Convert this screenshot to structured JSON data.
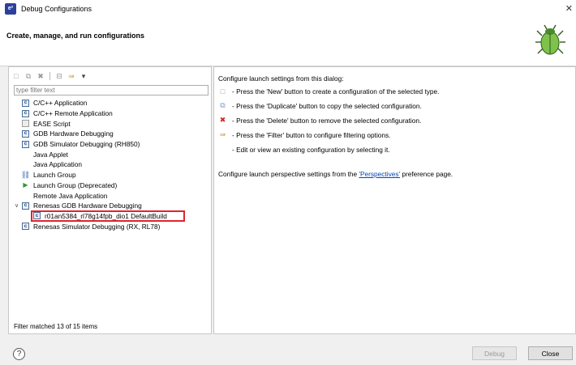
{
  "window": {
    "title": "Debug Configurations",
    "app_icon_text": "e²"
  },
  "header": {
    "title": "Create, manage, and run configurations"
  },
  "filter": {
    "placeholder": "type filter text"
  },
  "tree": [
    {
      "label": "C/C++ Application",
      "icon": "c-icon"
    },
    {
      "label": "C/C++ Remote Application",
      "icon": "c-icon"
    },
    {
      "label": "EASE Script",
      "icon": "script-icon"
    },
    {
      "label": "GDB Hardware Debugging",
      "icon": "c-icon"
    },
    {
      "label": "GDB Simulator Debugging (RH850)",
      "icon": "c-icon"
    },
    {
      "label": "Java Applet",
      "icon": "none"
    },
    {
      "label": "Java Application",
      "icon": "none"
    },
    {
      "label": "Launch Group",
      "icon": "group-icon"
    },
    {
      "label": "Launch Group (Deprecated)",
      "icon": "play-icon"
    },
    {
      "label": "Remote Java Application",
      "icon": "none"
    },
    {
      "label": "Renesas GDB Hardware Debugging",
      "icon": "c-icon",
      "expanded": true
    },
    {
      "label": "r01an5384_rl78g14fpb_dio1 DefaultBuild",
      "icon": "c-icon",
      "child": true
    },
    {
      "label": "Renesas Simulator Debugging (RX, RL78)",
      "icon": "c-icon"
    }
  ],
  "status": {
    "text": "Filter matched 13 of 15 items"
  },
  "right": {
    "intro": "Configure launch settings from this dialog:",
    "lines": [
      {
        "text": "- Press the 'New' button to create a configuration of the selected type.",
        "icon": "new-icon"
      },
      {
        "text": "- Press the 'Duplicate' button to copy the selected configuration.",
        "icon": "duplicate-icon"
      },
      {
        "text": "- Press the 'Delete' button to remove the selected configuration.",
        "icon": "delete-icon"
      },
      {
        "text": "- Press the 'Filter' button to configure filtering options.",
        "icon": "filter-icon"
      },
      {
        "text": "- Edit or view an existing configuration by selecting it.",
        "icon": "none"
      }
    ],
    "perspective_prefix": "Configure launch perspective settings from the ",
    "perspective_link": "'Perspectives'",
    "perspective_suffix": " preference page."
  },
  "buttons": {
    "debug": "Debug",
    "close": "Close",
    "help": "?"
  },
  "colors": {
    "highlight": "#e0232f",
    "link": "#0645ad"
  }
}
